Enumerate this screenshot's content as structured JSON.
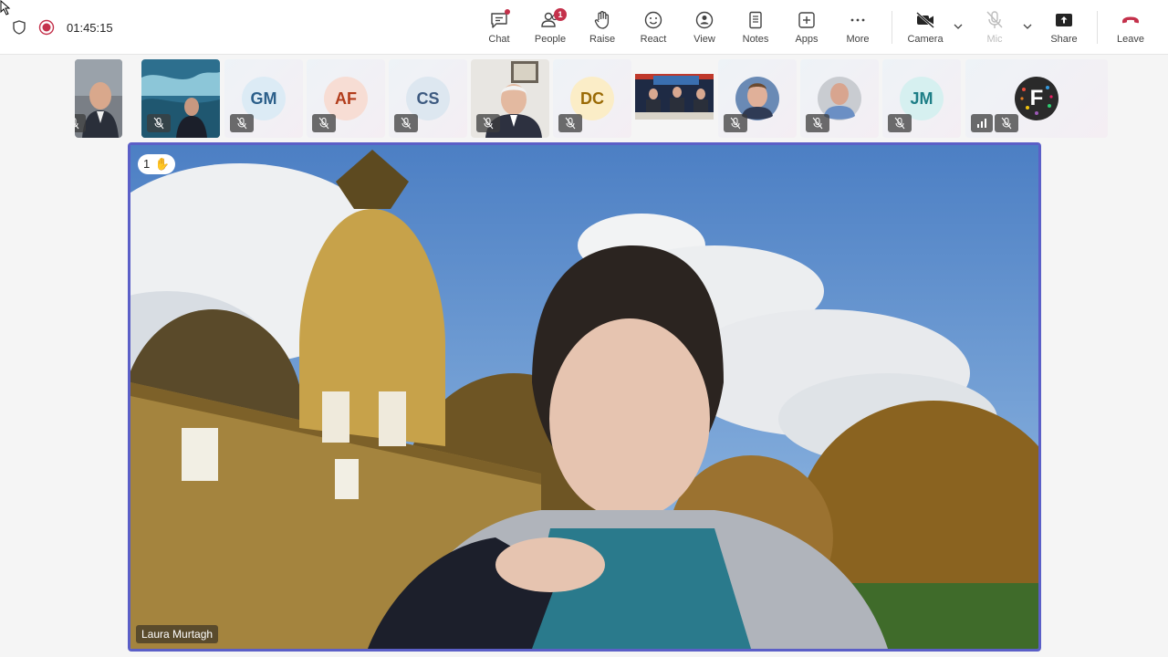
{
  "meeting": {
    "timer": "01:45:15",
    "accent_color": "#5b5fc7",
    "leave_color": "#c4314b"
  },
  "toolbar": {
    "chat_label": "Chat",
    "people_label": "People",
    "people_badge": "1",
    "raise_label": "Raise",
    "react_label": "React",
    "view_label": "View",
    "notes_label": "Notes",
    "apps_label": "Apps",
    "more_label": "More",
    "camera_label": "Camera",
    "mic_label": "Mic",
    "share_label": "Share",
    "leave_label": "Leave"
  },
  "participants": [
    {
      "type": "video"
    },
    {
      "type": "video"
    },
    {
      "type": "avatar",
      "initials": "GM",
      "color": "#2b5f8a",
      "bg": "#dcebf5"
    },
    {
      "type": "avatar",
      "initials": "AF",
      "color": "#b23c1b",
      "bg": "#f7ddd4"
    },
    {
      "type": "avatar",
      "initials": "CS",
      "color": "#3d5a80",
      "bg": "#dde7f0"
    },
    {
      "type": "video"
    },
    {
      "type": "avatar",
      "initials": "DC",
      "color": "#9a6a05",
      "bg": "#fbedc7"
    },
    {
      "type": "video"
    },
    {
      "type": "video"
    },
    {
      "type": "video"
    },
    {
      "type": "avatar",
      "initials": "JM",
      "color": "#1d7e86",
      "bg": "#d6f0f0"
    },
    {
      "type": "logo",
      "initials": "F"
    }
  ],
  "stage": {
    "raised_hand_count": "1",
    "speaker_name": "Laura Murtagh"
  }
}
